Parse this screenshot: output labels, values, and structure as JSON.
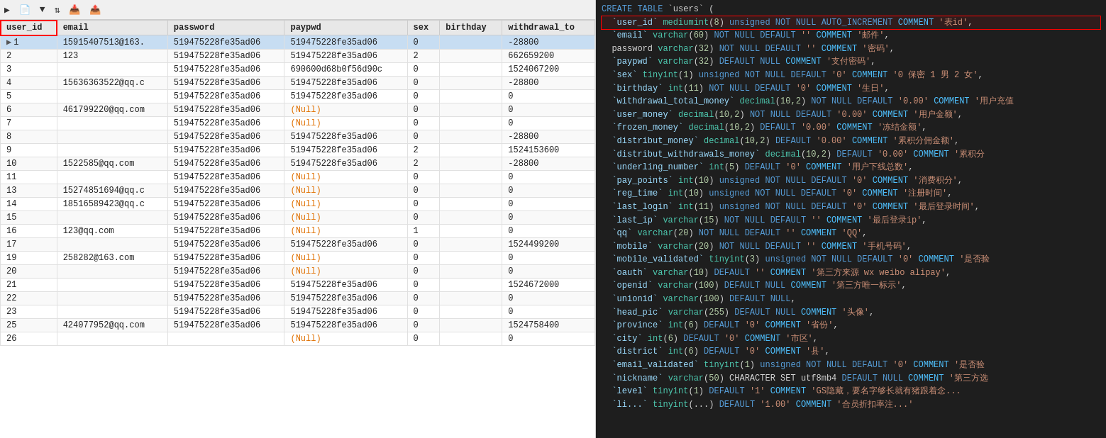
{
  "toolbar": {
    "items": [
      {
        "label": "开始事务",
        "icon": "▶"
      },
      {
        "label": "文本·",
        "icon": "📄"
      },
      {
        "label": "筛选",
        "icon": "▼"
      },
      {
        "label": "排序",
        "icon": "⇅"
      },
      {
        "label": "导入",
        "icon": "📥"
      },
      {
        "label": "导出",
        "icon": "📤"
      }
    ]
  },
  "table": {
    "columns": [
      "user_id",
      "email",
      "password",
      "paypwd",
      "sex",
      "birthday",
      "withdrawal_to"
    ],
    "rows": [
      {
        "user_id": "1",
        "email": "15915407513@163.",
        "password": "519475228fe35ad06",
        "paypwd": "519475228fe35ad06",
        "sex": "0",
        "birthday": "",
        "withdrawal_to": "-28800",
        "selected": true
      },
      {
        "user_id": "2",
        "email": "123",
        "password": "519475228fe35ad06",
        "paypwd": "519475228fe35ad06",
        "sex": "2",
        "birthday": "",
        "withdrawal_to": "662659200"
      },
      {
        "user_id": "3",
        "email": "",
        "password": "519475228fe35ad06",
        "paypwd": "690600d68b0f56d90c",
        "sex": "0",
        "birthday": "",
        "withdrawal_to": "1524067200"
      },
      {
        "user_id": "4",
        "email": "15636363522@qq.c",
        "password": "519475228fe35ad06",
        "paypwd": "519475228fe35ad06",
        "sex": "0",
        "birthday": "",
        "withdrawal_to": "-28800"
      },
      {
        "user_id": "5",
        "email": "",
        "password": "519475228fe35ad06",
        "paypwd": "519475228fe35ad06",
        "sex": "0",
        "birthday": "",
        "withdrawal_to": "0"
      },
      {
        "user_id": "6",
        "email": "461799220@qq.com",
        "password": "519475228fe35ad06",
        "paypwd": "(Null)",
        "sex": "0",
        "birthday": "",
        "withdrawal_to": "0",
        "paypwd_null": true
      },
      {
        "user_id": "7",
        "email": "",
        "password": "519475228fe35ad06",
        "paypwd": "(Null)",
        "sex": "0",
        "birthday": "",
        "withdrawal_to": "0",
        "paypwd_null": true
      },
      {
        "user_id": "8",
        "email": "",
        "password": "519475228fe35ad06",
        "paypwd": "519475228fe35ad06",
        "sex": "0",
        "birthday": "",
        "withdrawal_to": "-28800"
      },
      {
        "user_id": "9",
        "email": "",
        "password": "519475228fe35ad06",
        "paypwd": "519475228fe35ad06",
        "sex": "2",
        "birthday": "",
        "withdrawal_to": "1524153600"
      },
      {
        "user_id": "10",
        "email": "1522585@qq.com",
        "password": "519475228fe35ad06",
        "paypwd": "519475228fe35ad06",
        "sex": "2",
        "birthday": "",
        "withdrawal_to": "-28800"
      },
      {
        "user_id": "11",
        "email": "",
        "password": "519475228fe35ad06",
        "paypwd": "(Null)",
        "sex": "0",
        "birthday": "",
        "withdrawal_to": "0",
        "paypwd_null": true
      },
      {
        "user_id": "13",
        "email": "15274851694@qq.c",
        "password": "519475228fe35ad06",
        "paypwd": "(Null)",
        "sex": "0",
        "birthday": "",
        "withdrawal_to": "0",
        "paypwd_null": true
      },
      {
        "user_id": "14",
        "email": "18516589423@qq.c",
        "password": "519475228fe35ad06",
        "paypwd": "(Null)",
        "sex": "0",
        "birthday": "",
        "withdrawal_to": "0",
        "paypwd_null": true
      },
      {
        "user_id": "15",
        "email": "",
        "password": "519475228fe35ad06",
        "paypwd": "(Null)",
        "sex": "0",
        "birthday": "",
        "withdrawal_to": "0",
        "paypwd_null": true
      },
      {
        "user_id": "16",
        "email": "123@qq.com",
        "password": "519475228fe35ad06",
        "paypwd": "(Null)",
        "sex": "1",
        "birthday": "",
        "withdrawal_to": "0",
        "paypwd_null": true
      },
      {
        "user_id": "17",
        "email": "",
        "password": "519475228fe35ad06",
        "paypwd": "519475228fe35ad06",
        "sex": "0",
        "birthday": "",
        "withdrawal_to": "1524499200"
      },
      {
        "user_id": "19",
        "email": "258282@163.com",
        "password": "519475228fe35ad06",
        "paypwd": "(Null)",
        "sex": "0",
        "birthday": "",
        "withdrawal_to": "0",
        "paypwd_null": true
      },
      {
        "user_id": "20",
        "email": "",
        "password": "519475228fe35ad06",
        "paypwd": "(Null)",
        "sex": "0",
        "birthday": "",
        "withdrawal_to": "0",
        "paypwd_null": true
      },
      {
        "user_id": "21",
        "email": "",
        "password": "519475228fe35ad06",
        "paypwd": "519475228fe35ad06",
        "sex": "0",
        "birthday": "",
        "withdrawal_to": "1524672000"
      },
      {
        "user_id": "22",
        "email": "",
        "password": "519475228fe35ad06",
        "paypwd": "519475228fe35ad06",
        "sex": "0",
        "birthday": "",
        "withdrawal_to": "0"
      },
      {
        "user_id": "23",
        "email": "",
        "password": "519475228fe35ad06",
        "paypwd": "519475228fe35ad06",
        "sex": "0",
        "birthday": "",
        "withdrawal_to": "0"
      },
      {
        "user_id": "25",
        "email": "424077952@qq.com",
        "password": "519475228fe35ad06",
        "paypwd": "519475228fe35ad06",
        "sex": "0",
        "birthday": "",
        "withdrawal_to": "1524758400"
      },
      {
        "user_id": "26",
        "email": "",
        "password": "",
        "paypwd": "(Null)",
        "sex": "0",
        "birthday": "",
        "withdrawal_to": "0",
        "paypwd_null": true
      }
    ]
  },
  "sql": {
    "title": "CREATE TABLE `users` (",
    "lines": [
      "`user_id` mediumint(8) unsigned NOT NULL AUTO_INCREMENT COMMENT '表id',",
      "`email` varchar(60) NOT NULL DEFAULT '' COMMENT '邮件',",
      "password varchar(32) NOT NULL DEFAULT '' COMMENT '密码',",
      "`paypwd` varchar(32) DEFAULT NULL COMMENT '支付密码',",
      "`sex` tinyint(1) unsigned NOT NULL DEFAULT '0' COMMENT '0 保密 1 男 2 女',",
      "`birthday` int(11) NOT NULL DEFAULT '0' COMMENT '生日',",
      "`withdrawal_total_money` decimal(10,2) NOT NULL DEFAULT '0.00' COMMENT '用户充值',",
      "`user_money` decimal(10,2) NOT NULL DEFAULT '0.00' COMMENT '用户金额',",
      "`frozen_money` decimal(10,2) DEFAULT '0.00' COMMENT '冻结金额',",
      "`distribut_money` decimal(10,2) DEFAULT '0.00' COMMENT '累积分佣金额',",
      "`distribut_withdrawals_money` decimal(10,2) DEFAULT '0.00' COMMENT '累积分",
      "`underling_number` int(5) DEFAULT '0' COMMENT '用户下线总数',",
      "`pay_points` int(10) unsigned NOT NULL DEFAULT '0' COMMENT '消费积分',",
      "`reg_time` int(10) unsigned NOT NULL DEFAULT '0' COMMENT '注册时间',",
      "`last_login` int(11) unsigned NOT NULL DEFAULT '0' COMMENT '最后登录时间',",
      "`last_ip` varchar(15) NOT NULL DEFAULT '' COMMENT '最后登录ip',",
      "`qq` varchar(20) NOT NULL DEFAULT '' COMMENT 'QQ',",
      "`mobile` varchar(20) NOT NULL DEFAULT '' COMMENT '手机号码',",
      "`mobile_validated` tinyint(3) unsigned NOT NULL DEFAULT '0' COMMENT '是否验",
      "`oauth` varchar(10) DEFAULT '' COMMENT '第三方来源 wx weibo alipay',",
      "`openid` varchar(100) DEFAULT NULL COMMENT '第三方唯一标示',",
      "`unionid` varchar(100) DEFAULT NULL,",
      "`head_pic` varchar(255) DEFAULT NULL COMMENT '头像',",
      "`province` int(6) DEFAULT '0' COMMENT '省份',",
      "`city` int(6) DEFAULT '0' COMMENT '市区',",
      "`district` int(6) DEFAULT '0' COMMENT '县',",
      "`email_validated` tinyint(1) unsigned NOT NULL DEFAULT '0' COMMENT '是否验",
      "`nickname` varchar(50) CHARACTER SET utf8mb4 DEFAULT NULL COMMENT '第三方选",
      "`level` tinyint(1) DEFAULT '1' COMMENT 'GS隐藏，要名字够长就有猪跟着念...",
      "`li...` tinyint(...) DEFAULT '1.00' COMMENT '合员折扣率注...'"
    ]
  }
}
